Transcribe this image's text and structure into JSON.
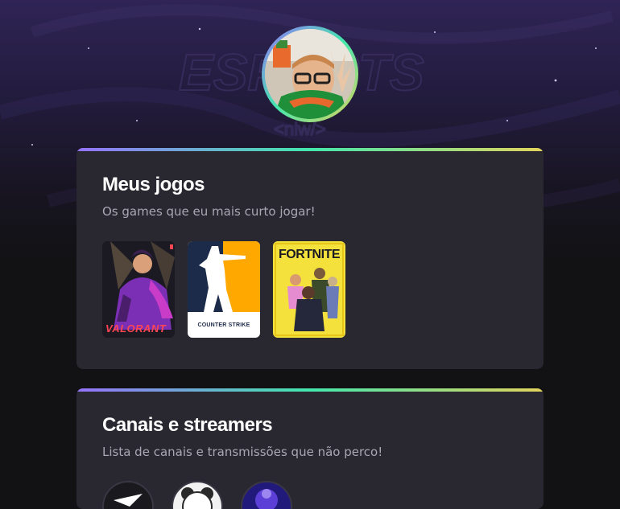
{
  "profile": {
    "avatar_alt": "profile-photo"
  },
  "games_section": {
    "title": "Meus jogos",
    "subtitle": "Os games que eu mais curto jogar!",
    "games": [
      {
        "name": "VALORANT",
        "color": "#1b1a22"
      },
      {
        "name": "COUNTER STRIKE",
        "color": "#ffa800"
      },
      {
        "name": "FORTNITE",
        "color": "#f5e13b"
      }
    ]
  },
  "channels_section": {
    "title": "Canais e streamers",
    "subtitle": "Lista de canais e transmissões que não perco!"
  },
  "colors": {
    "background": "#121214",
    "card": "#29272f",
    "gradient": [
      "#9572fc",
      "#43e7ad",
      "#e2d45c"
    ],
    "valorant_red": "#ff4655"
  }
}
